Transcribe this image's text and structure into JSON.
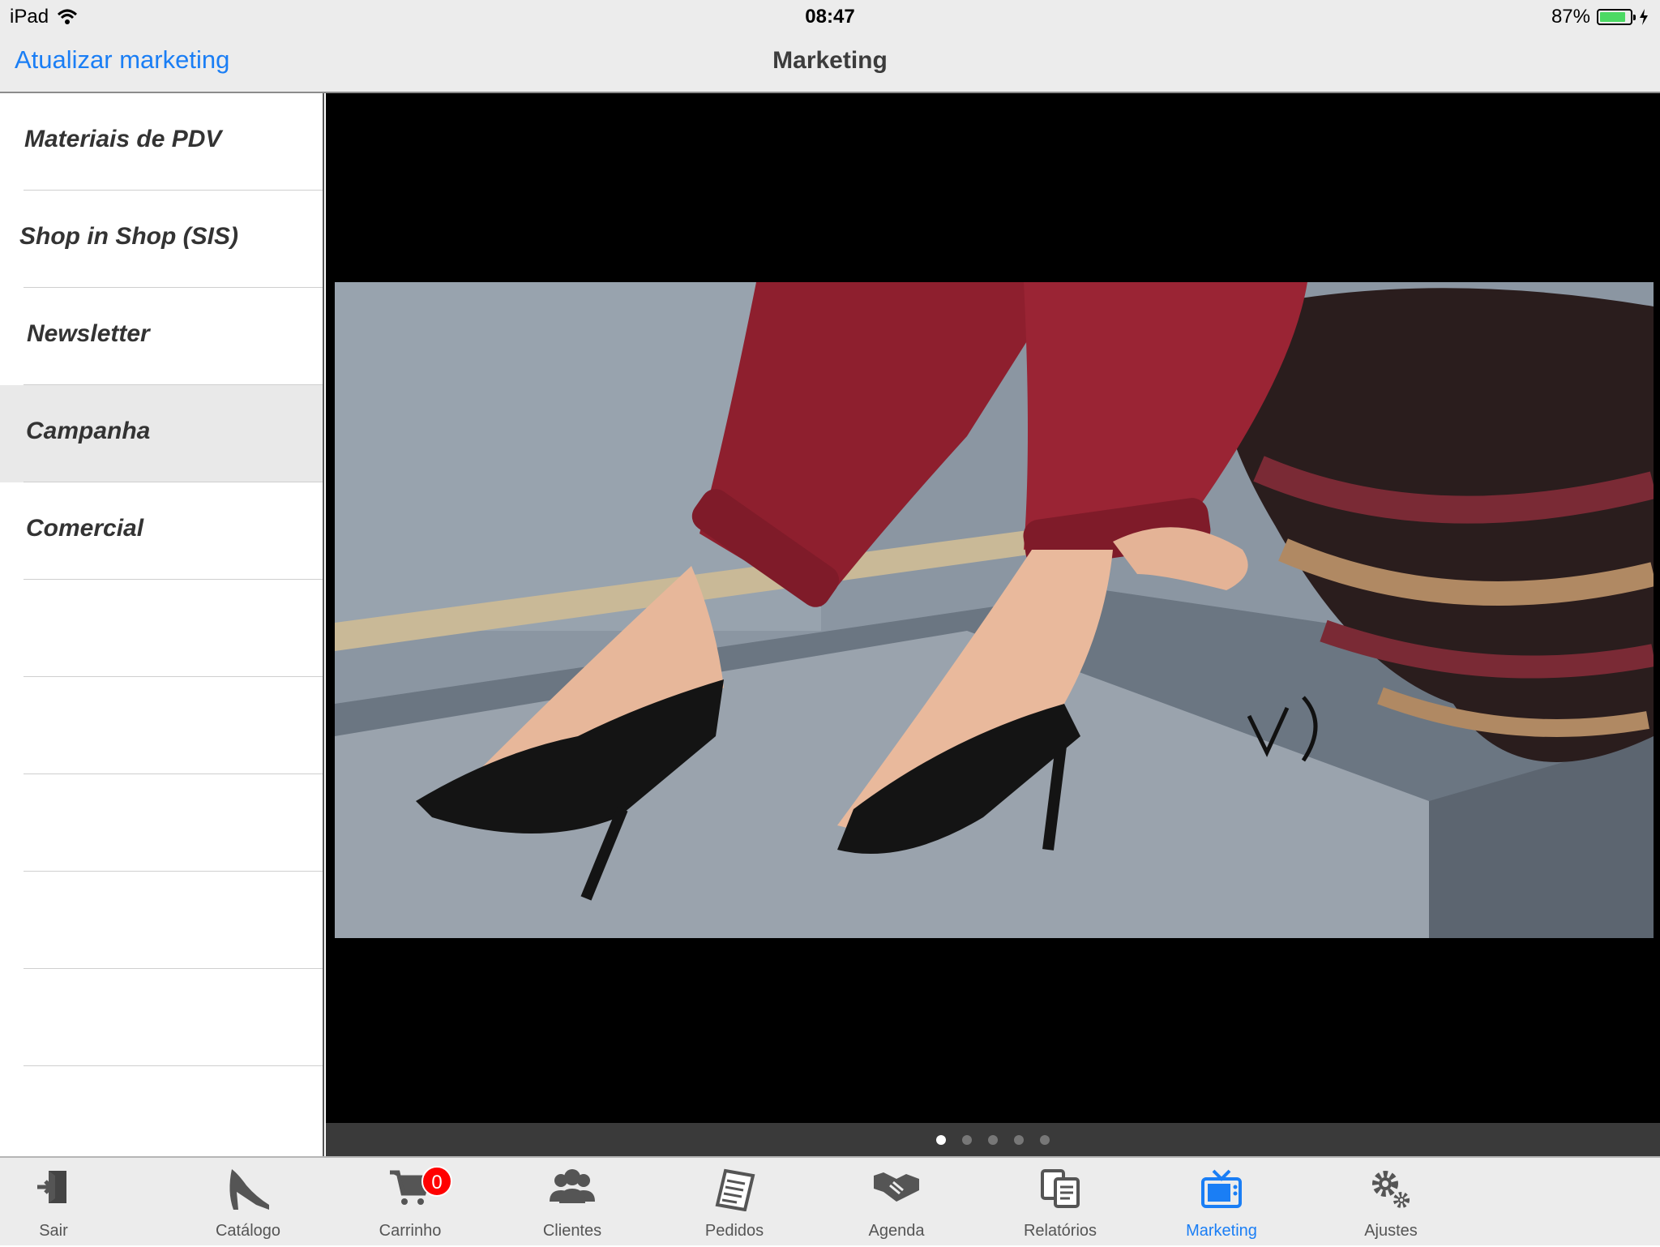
{
  "status_bar": {
    "device": "iPad",
    "time": "08:47",
    "battery_text": "87%",
    "battery_level": 0.87
  },
  "nav": {
    "back_label": "Atualizar marketing",
    "title": "Marketing"
  },
  "sidebar": {
    "items": [
      {
        "label": "Materiais de PDV",
        "selected": false
      },
      {
        "label": "Shop in Shop (SIS)",
        "selected": false
      },
      {
        "label": "Newsletter",
        "selected": false
      },
      {
        "label": "Campanha",
        "selected": true
      },
      {
        "label": "Comercial",
        "selected": false
      }
    ]
  },
  "gallery": {
    "page_count": 5,
    "current_page": 1,
    "watermark_logo": "V)"
  },
  "tabs": [
    {
      "label": "Sair",
      "icon": "exit-icon"
    },
    {
      "label": "Catálogo",
      "icon": "high-heel-icon"
    },
    {
      "label": "Carrinho",
      "icon": "cart-icon",
      "badge": "0"
    },
    {
      "label": "Clientes",
      "icon": "users-icon"
    },
    {
      "label": "Pedidos",
      "icon": "document-icon"
    },
    {
      "label": "Agenda",
      "icon": "handshake-icon"
    },
    {
      "label": "Relatórios",
      "icon": "reports-icon"
    },
    {
      "label": "Marketing",
      "icon": "tv-icon",
      "active": true
    },
    {
      "label": "Ajustes",
      "icon": "gears-icon"
    }
  ],
  "colors": {
    "accent": "#1a7ef5",
    "badge": "#ff0000",
    "battery": "#4cd964"
  }
}
